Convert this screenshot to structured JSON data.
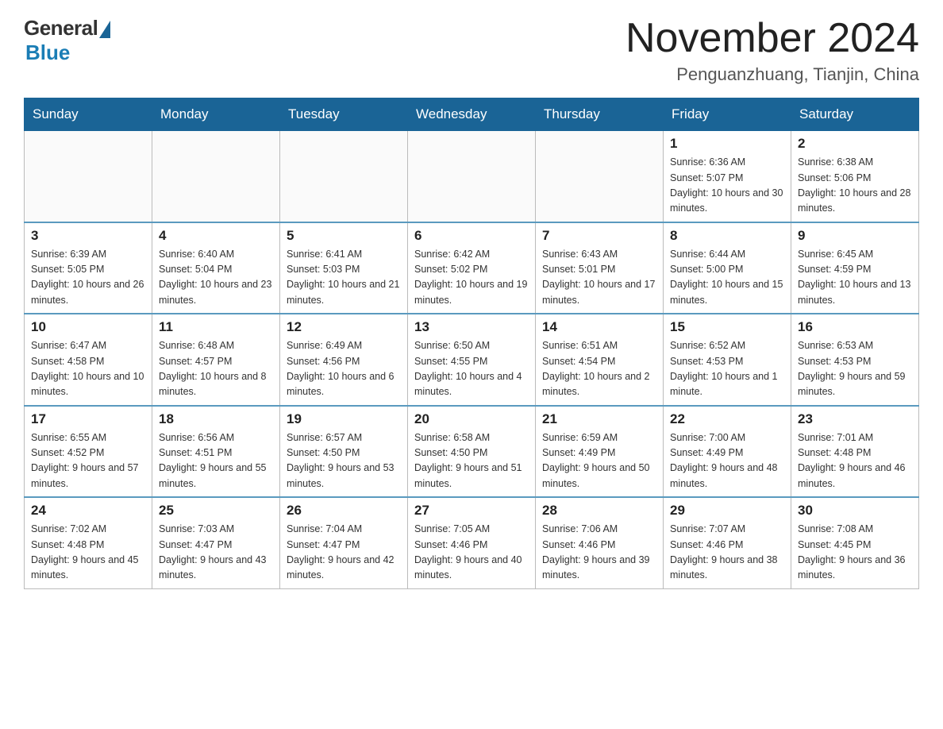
{
  "header": {
    "logo_general": "General",
    "logo_blue": "Blue",
    "month_title": "November 2024",
    "location": "Penguanzhuang, Tianjin, China"
  },
  "days_of_week": [
    "Sunday",
    "Monday",
    "Tuesday",
    "Wednesday",
    "Thursday",
    "Friday",
    "Saturday"
  ],
  "weeks": [
    [
      {
        "day": "",
        "info": ""
      },
      {
        "day": "",
        "info": ""
      },
      {
        "day": "",
        "info": ""
      },
      {
        "day": "",
        "info": ""
      },
      {
        "day": "",
        "info": ""
      },
      {
        "day": "1",
        "info": "Sunrise: 6:36 AM\nSunset: 5:07 PM\nDaylight: 10 hours and 30 minutes."
      },
      {
        "day": "2",
        "info": "Sunrise: 6:38 AM\nSunset: 5:06 PM\nDaylight: 10 hours and 28 minutes."
      }
    ],
    [
      {
        "day": "3",
        "info": "Sunrise: 6:39 AM\nSunset: 5:05 PM\nDaylight: 10 hours and 26 minutes."
      },
      {
        "day": "4",
        "info": "Sunrise: 6:40 AM\nSunset: 5:04 PM\nDaylight: 10 hours and 23 minutes."
      },
      {
        "day": "5",
        "info": "Sunrise: 6:41 AM\nSunset: 5:03 PM\nDaylight: 10 hours and 21 minutes."
      },
      {
        "day": "6",
        "info": "Sunrise: 6:42 AM\nSunset: 5:02 PM\nDaylight: 10 hours and 19 minutes."
      },
      {
        "day": "7",
        "info": "Sunrise: 6:43 AM\nSunset: 5:01 PM\nDaylight: 10 hours and 17 minutes."
      },
      {
        "day": "8",
        "info": "Sunrise: 6:44 AM\nSunset: 5:00 PM\nDaylight: 10 hours and 15 minutes."
      },
      {
        "day": "9",
        "info": "Sunrise: 6:45 AM\nSunset: 4:59 PM\nDaylight: 10 hours and 13 minutes."
      }
    ],
    [
      {
        "day": "10",
        "info": "Sunrise: 6:47 AM\nSunset: 4:58 PM\nDaylight: 10 hours and 10 minutes."
      },
      {
        "day": "11",
        "info": "Sunrise: 6:48 AM\nSunset: 4:57 PM\nDaylight: 10 hours and 8 minutes."
      },
      {
        "day": "12",
        "info": "Sunrise: 6:49 AM\nSunset: 4:56 PM\nDaylight: 10 hours and 6 minutes."
      },
      {
        "day": "13",
        "info": "Sunrise: 6:50 AM\nSunset: 4:55 PM\nDaylight: 10 hours and 4 minutes."
      },
      {
        "day": "14",
        "info": "Sunrise: 6:51 AM\nSunset: 4:54 PM\nDaylight: 10 hours and 2 minutes."
      },
      {
        "day": "15",
        "info": "Sunrise: 6:52 AM\nSunset: 4:53 PM\nDaylight: 10 hours and 1 minute."
      },
      {
        "day": "16",
        "info": "Sunrise: 6:53 AM\nSunset: 4:53 PM\nDaylight: 9 hours and 59 minutes."
      }
    ],
    [
      {
        "day": "17",
        "info": "Sunrise: 6:55 AM\nSunset: 4:52 PM\nDaylight: 9 hours and 57 minutes."
      },
      {
        "day": "18",
        "info": "Sunrise: 6:56 AM\nSunset: 4:51 PM\nDaylight: 9 hours and 55 minutes."
      },
      {
        "day": "19",
        "info": "Sunrise: 6:57 AM\nSunset: 4:50 PM\nDaylight: 9 hours and 53 minutes."
      },
      {
        "day": "20",
        "info": "Sunrise: 6:58 AM\nSunset: 4:50 PM\nDaylight: 9 hours and 51 minutes."
      },
      {
        "day": "21",
        "info": "Sunrise: 6:59 AM\nSunset: 4:49 PM\nDaylight: 9 hours and 50 minutes."
      },
      {
        "day": "22",
        "info": "Sunrise: 7:00 AM\nSunset: 4:49 PM\nDaylight: 9 hours and 48 minutes."
      },
      {
        "day": "23",
        "info": "Sunrise: 7:01 AM\nSunset: 4:48 PM\nDaylight: 9 hours and 46 minutes."
      }
    ],
    [
      {
        "day": "24",
        "info": "Sunrise: 7:02 AM\nSunset: 4:48 PM\nDaylight: 9 hours and 45 minutes."
      },
      {
        "day": "25",
        "info": "Sunrise: 7:03 AM\nSunset: 4:47 PM\nDaylight: 9 hours and 43 minutes."
      },
      {
        "day": "26",
        "info": "Sunrise: 7:04 AM\nSunset: 4:47 PM\nDaylight: 9 hours and 42 minutes."
      },
      {
        "day": "27",
        "info": "Sunrise: 7:05 AM\nSunset: 4:46 PM\nDaylight: 9 hours and 40 minutes."
      },
      {
        "day": "28",
        "info": "Sunrise: 7:06 AM\nSunset: 4:46 PM\nDaylight: 9 hours and 39 minutes."
      },
      {
        "day": "29",
        "info": "Sunrise: 7:07 AM\nSunset: 4:46 PM\nDaylight: 9 hours and 38 minutes."
      },
      {
        "day": "30",
        "info": "Sunrise: 7:08 AM\nSunset: 4:45 PM\nDaylight: 9 hours and 36 minutes."
      }
    ]
  ]
}
